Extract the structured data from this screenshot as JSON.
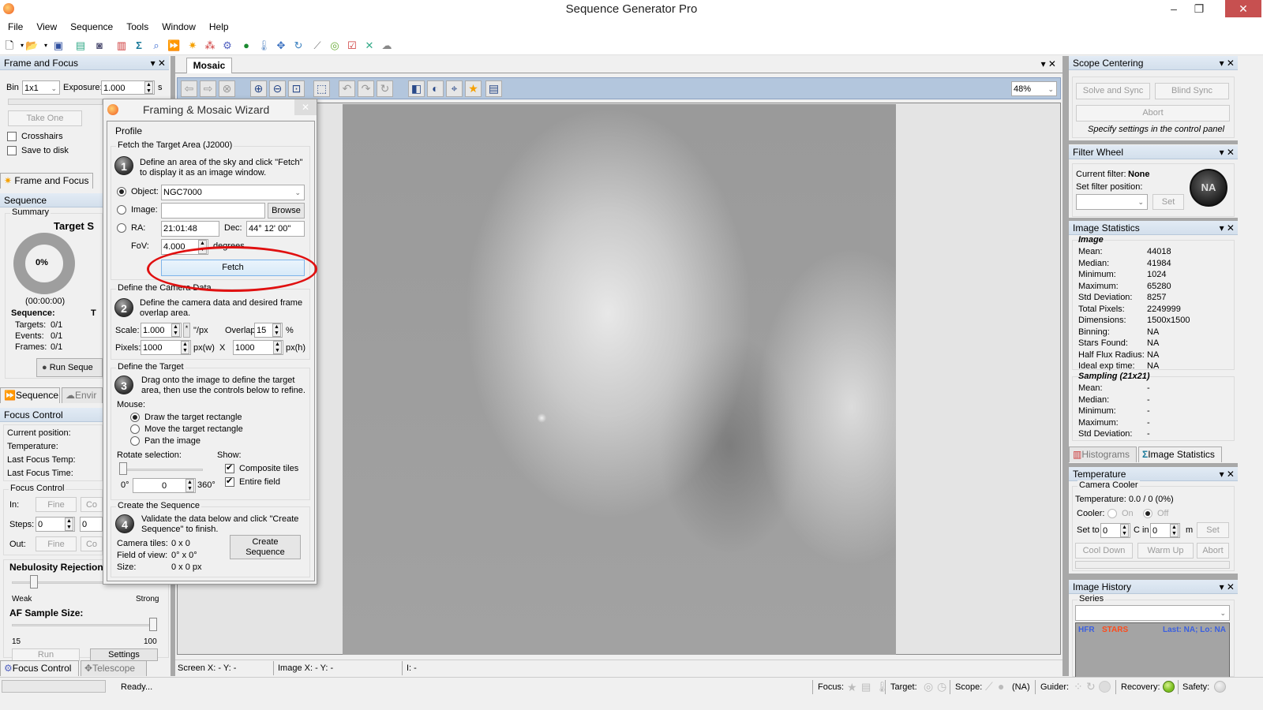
{
  "app": {
    "title": "Sequence Generator Pro"
  },
  "menu": [
    "File",
    "View",
    "Sequence",
    "Tools",
    "Window",
    "Help"
  ],
  "toolbar_icons": [
    "new-icon",
    "dropdown-icon",
    "open-folder-icon",
    "dropdown-icon",
    "save-icon",
    "equipment-profile-icon",
    "camera-icon",
    "histogram-icon",
    "sigma-icon",
    "zoom-icon",
    "sequence-icon",
    "sun-icon",
    "filter-icon",
    "gears-icon",
    "target-icon",
    "thermometer-icon",
    "move-icon",
    "rotate-icon",
    "telescope-icon",
    "crosshair-target-icon",
    "checklist-icon",
    "plate-solve-icon",
    "weather-icon"
  ],
  "frame_focus": {
    "title": "Frame and Focus",
    "bin_label": "Bin",
    "bin_value": "1x1",
    "exposure_label": "Exposure:",
    "exposure_value": "1.000",
    "exposure_unit": "s",
    "take_one": "Take One",
    "crosshairs": "Crosshairs",
    "save_to_disk": "Save to disk",
    "tab_label": "Frame and Focus"
  },
  "sequence": {
    "title": "Sequence",
    "summary": "Summary",
    "target_status": "Target S",
    "progress_percent": "0%",
    "progress_fraction": 0,
    "elapsed": "(00:00:00)",
    "seq_label": "Sequence:",
    "second_col_label": "T",
    "targets_label": "Targets:",
    "targets": "0/1",
    "events_label": "Events:",
    "events": "0/1",
    "frames_label": "Frames:",
    "frames": "0/1",
    "run_button": "Run Seque",
    "tab_sequence": "Sequence",
    "tab_environment": "Envir"
  },
  "focus_control": {
    "title": "Focus Control",
    "current_position": "Current position:",
    "temperature": "Temperature:",
    "last_focus_temp": "Last Focus Temp:",
    "last_focus_time": "Last Focus Time:",
    "group_title": "Focus Control",
    "in_label": "In:",
    "fine": "Fine",
    "coarse": "Co",
    "steps_label": "Steps:",
    "steps_value": "0",
    "steps_value2": "0",
    "out_label": "Out:",
    "nebulosity_title": "Nebulosity Rejection",
    "weak": "Weak",
    "strong": "Strong",
    "nebulosity_level": 0.15,
    "af_sample_title": "AF Sample Size:",
    "af_min": "15",
    "af_max": "100",
    "af_value_fraction": 1.0,
    "run": "Run",
    "settings": "Settings",
    "tab_focus": "Focus Control",
    "tab_telescope": "Telescope"
  },
  "mosaic": {
    "tab": "Mosaic",
    "zoom_value": "48%",
    "tools": [
      "back-arrow-icon",
      "forward-arrow-icon",
      "cancel-icon",
      "zoom-in-icon",
      "zoom-out-icon",
      "zoom-fit-icon",
      "selection-rect-icon",
      "rotate-left-icon",
      "rotate-right-icon",
      "rotate-180-icon",
      "contrast-icon",
      "half-circle-icon",
      "crosshair-icon",
      "star-icon",
      "notes-icon"
    ],
    "status_screen": "Screen X: - Y: -",
    "status_image": "Image X: - Y: -",
    "status_intensity": "I: -"
  },
  "wizard": {
    "title": "Framing & Mosaic Wizard",
    "profile": "Profile",
    "step1_group": "Fetch the Target Area (J2000)",
    "step1_num": "1",
    "step1_text_1": "Define an area of the sky and click \"Fetch\"",
    "step1_text_2": "to display it as an image window.",
    "object_label": "Object:",
    "object_value": "NGC7000",
    "image_label": "Image:",
    "image_value": "",
    "browse": "Browse",
    "ra_label": "RA:",
    "ra_value": "21:01:48",
    "dec_label": "Dec:",
    "dec_value": "44° 12' 00\"",
    "fov_label": "FoV:",
    "fov_value": "4.000",
    "fov_unit": "degrees",
    "fetch": "Fetch",
    "step2_group": "Define the Camera Data",
    "step2_num": "2",
    "step2_text_1": "Define the camera data and desired frame",
    "step2_text_2": "overlap area.",
    "scale_label": "Scale:",
    "scale_value": "1.000",
    "scale_unit": "\"/px",
    "scale_btn": "*",
    "overlap_label": "Overlap:",
    "overlap_value": "15",
    "overlap_unit": "%",
    "pixels_label": "Pixels:",
    "pixels_w": "1000",
    "pixels_w_unit": "px(w)",
    "x_sep": "X",
    "pixels_h": "1000",
    "pixels_h_unit": "px(h)",
    "step3_group": "Define the Target",
    "step3_num": "3",
    "step3_text_1": "Drag onto the image to define the target",
    "step3_text_2": "area, then use the controls below to refine.",
    "mouse_label": "Mouse:",
    "mouse_draw": "Draw the target rectangle",
    "mouse_move": "Move the target rectangle",
    "mouse_pan": "Pan the image",
    "rotate_label": "Rotate selection:",
    "rotate_min": "0°",
    "rotate_value": "0",
    "rotate_max": "360°",
    "show_label": "Show:",
    "composite_tiles": "Composite tiles",
    "entire_field": "Entire field",
    "step4_group": "Create the Sequence",
    "step4_num": "4",
    "step4_text_1": "Validate the data below and click \"Create",
    "step4_text_2": "Sequence\" to finish.",
    "camera_tiles_label": "Camera tiles:",
    "camera_tiles": "0 x 0",
    "fov2_label": "Field of view:",
    "fov2": "0° x 0°",
    "size_label": "Size:",
    "size": "0 x 0 px",
    "create_1": "Create",
    "create_2": "Sequence"
  },
  "scope_centering": {
    "title": "Scope Centering",
    "solve_sync": "Solve and Sync",
    "blind_sync": "Blind Sync",
    "abort": "Abort",
    "hint": "Specify settings in the control panel"
  },
  "filter_wheel": {
    "title": "Filter Wheel",
    "current_label": "Current filter:",
    "current_value": "None",
    "set_position_label": "Set filter position:",
    "set": "Set",
    "indicator": "NA"
  },
  "image_statistics": {
    "title": "Image Statistics",
    "image_header": "Image",
    "rows": [
      {
        "label": "Mean:",
        "value": "44018"
      },
      {
        "label": "Median:",
        "value": "41984"
      },
      {
        "label": "Minimum:",
        "value": "1024"
      },
      {
        "label": "Maximum:",
        "value": "65280"
      },
      {
        "label": "Std Deviation:",
        "value": "8257"
      },
      {
        "label": "Total Pixels:",
        "value": "2249999"
      },
      {
        "label": "Dimensions:",
        "value": "1500x1500"
      },
      {
        "label": "Binning:",
        "value": "NA"
      },
      {
        "label": "Stars Found:",
        "value": "NA"
      },
      {
        "label": "Half Flux Radius:",
        "value": "NA"
      },
      {
        "label": "Ideal exp time:",
        "value": "NA"
      }
    ],
    "sampling_header": "Sampling (21x21)",
    "sampling_rows": [
      {
        "label": "Mean:",
        "value": "-"
      },
      {
        "label": "Median:",
        "value": "-"
      },
      {
        "label": "Minimum:",
        "value": "-"
      },
      {
        "label": "Maximum:",
        "value": "-"
      },
      {
        "label": "Std Deviation:",
        "value": "-"
      }
    ],
    "tab_histograms": "Histograms",
    "tab_stats": "Image Statistics"
  },
  "temperature": {
    "title": "Temperature",
    "group": "Camera Cooler",
    "temp_text": "Temperature: 0.0 / 0 (0%)",
    "cooler_label": "Cooler:",
    "on": "On",
    "off": "Off",
    "set_to_label": "Set to",
    "set_to_value": "0",
    "c_in_label": "C in",
    "minutes_value": "0",
    "m_label": "m",
    "set": "Set",
    "cool_down": "Cool Down",
    "warm_up": "Warm Up",
    "abort": "Abort"
  },
  "image_history": {
    "title": "Image History",
    "series_label": "Series",
    "hfr": "HFR",
    "stars": "STARS",
    "last": "Last: NA; Lo: NA",
    "hfr_color": "#3a5fe0",
    "stars_color": "#ff4a1a"
  },
  "statusbar": {
    "ready": "Ready...",
    "focus": "Focus:",
    "target": "Target:",
    "scope": "Scope:",
    "scope_value": "(NA)",
    "guider": "Guider:",
    "recovery": "Recovery:",
    "safety": "Safety:",
    "recovery_color": "#7cc020"
  }
}
